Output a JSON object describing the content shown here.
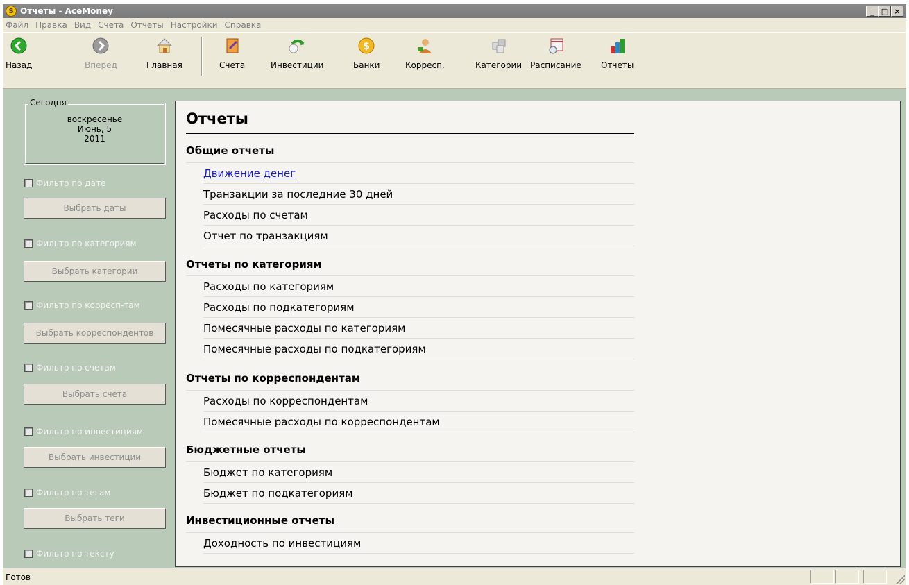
{
  "window": {
    "title": "Отчеты - AceMoney",
    "app_icon_glyph": "S",
    "buttons": {
      "minimize": "_",
      "maximize": "□",
      "close": "×"
    }
  },
  "menu": [
    "Файл",
    "Правка",
    "Вид",
    "Счета",
    "Отчеты",
    "Настройки",
    "Справка"
  ],
  "toolbar": {
    "back": "Назад",
    "forward": "Вперед",
    "home": "Главная",
    "accounts": "Счета",
    "investments": "Инвестиции",
    "banks": "Банки",
    "payees": "Корресп.",
    "categories": "Категории",
    "schedule": "Расписание",
    "reports": "Отчеты"
  },
  "today": {
    "legend": "Сегодня",
    "weekday": "воскресенье",
    "date": "Июнь, 5",
    "year": "2011"
  },
  "filters": [
    {
      "check": "Фильтр по дате",
      "button": "Выбрать даты"
    },
    {
      "check": "Фильтр по категориям",
      "button": "Выбрать категории"
    },
    {
      "check": "Фильтр по корресп-там",
      "button": "Выбрать корреспондентов"
    },
    {
      "check": "Фильтр по счетам",
      "button": "Выбрать счета"
    },
    {
      "check": "Фильтр по инвестициям",
      "button": "Выбрать инвестиции"
    },
    {
      "check": "Фильтр по тегам",
      "button": "Выбрать теги"
    },
    {
      "check": "Фильтр по тексту",
      "button": ""
    }
  ],
  "reports": {
    "title": "Отчеты",
    "sections": [
      {
        "name": "Общие отчеты",
        "items": [
          "Движение денег",
          "Транзакции за последние 30 дней",
          "Расходы по счетам",
          "Отчет по транзакциям"
        ]
      },
      {
        "name": "Отчеты по категориям",
        "items": [
          "Расходы по категориям",
          "Расходы по подкатегориям",
          "Помесячные расходы по категориям",
          "Помесячные расходы по подкатегориям"
        ]
      },
      {
        "name": "Отчеты по корреспондентам",
        "items": [
          "Расходы по корреспондентам",
          "Помесячные расходы по корреспондентам"
        ]
      },
      {
        "name": "Бюджетные отчеты",
        "items": [
          "Бюджет по категориям",
          "Бюджет по подкатегориям"
        ]
      },
      {
        "name": "Инвестиционные отчеты",
        "items": [
          "Доходность по инвестициям"
        ]
      }
    ]
  },
  "status": {
    "text": "Готов"
  }
}
